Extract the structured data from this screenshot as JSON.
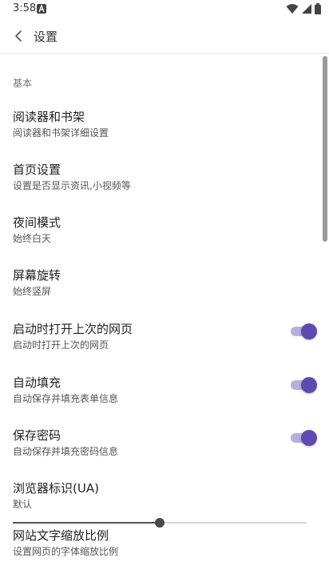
{
  "status_bar": {
    "time": "3:58"
  },
  "app_bar": {
    "title": "设置"
  },
  "section": {
    "header": "基本"
  },
  "settings": [
    {
      "title": "阅读器和书架",
      "subtitle": "阅读器和书架详细设置"
    },
    {
      "title": "首页设置",
      "subtitle": "设置是否显示资讯,小视频等"
    },
    {
      "title": "夜间模式",
      "subtitle": "始终白天"
    },
    {
      "title": "屏幕旋转",
      "subtitle": "始终竖屏"
    },
    {
      "title": "启动时打开上次的网页",
      "subtitle": "启动时打开上次的网页",
      "toggle": true
    },
    {
      "title": "自动填充",
      "subtitle": "自动保存并填充表单信息",
      "toggle": true
    },
    {
      "title": "保存密码",
      "subtitle": "自动保存并填充密码信息",
      "toggle": true
    },
    {
      "title": "浏览器标识(UA)",
      "subtitle": "默认"
    },
    {
      "title": "网站文字缩放比例",
      "subtitle": "设置网页的字体缩放比例"
    }
  ],
  "font_scale": {
    "level": 0.5
  },
  "colors": {
    "accent": "#5e4bb0",
    "accent_track": "#b7aee0"
  }
}
